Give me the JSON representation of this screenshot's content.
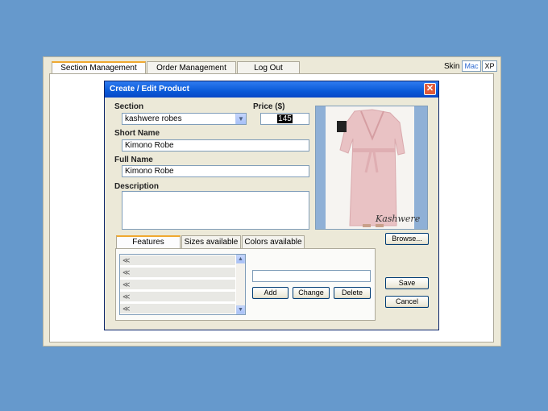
{
  "tabs": [
    {
      "label": "Section Management",
      "active": true
    },
    {
      "label": "Order Management",
      "active": false
    },
    {
      "label": "Log Out",
      "active": false
    }
  ],
  "skin": {
    "label": "Skin",
    "options": [
      {
        "label": "Mac",
        "active": true
      },
      {
        "label": "XP",
        "active": false
      }
    ]
  },
  "dialog": {
    "title": "Create / Edit Product",
    "close_symbol": "✕",
    "section_label": "Section",
    "section_value": "kashwere robes",
    "price_label": "Price ($)",
    "price_value": "145",
    "short_name_label": "Short Name",
    "short_name_value": "Kimono Robe",
    "full_name_label": "Full Name",
    "full_name_value": "Kimono Robe",
    "description_label": "Description",
    "description_value": "",
    "browse_label": "Browse...",
    "save_label": "Save",
    "cancel_label": "Cancel",
    "photo_brand_text": "Kashwere"
  },
  "subtabs": [
    {
      "label": "Features",
      "active": true
    },
    {
      "label": "Sizes available",
      "active": false
    },
    {
      "label": "Colors available",
      "active": false
    }
  ],
  "features": {
    "items": [
      "≪",
      "≪",
      "≪",
      "≪",
      "≪"
    ],
    "input_value": "",
    "add_label": "Add",
    "change_label": "Change",
    "delete_label": "Delete"
  },
  "colors": {
    "accent": "#f0a830",
    "titlebar": "#0a5ad8",
    "background": "#6699cc"
  }
}
